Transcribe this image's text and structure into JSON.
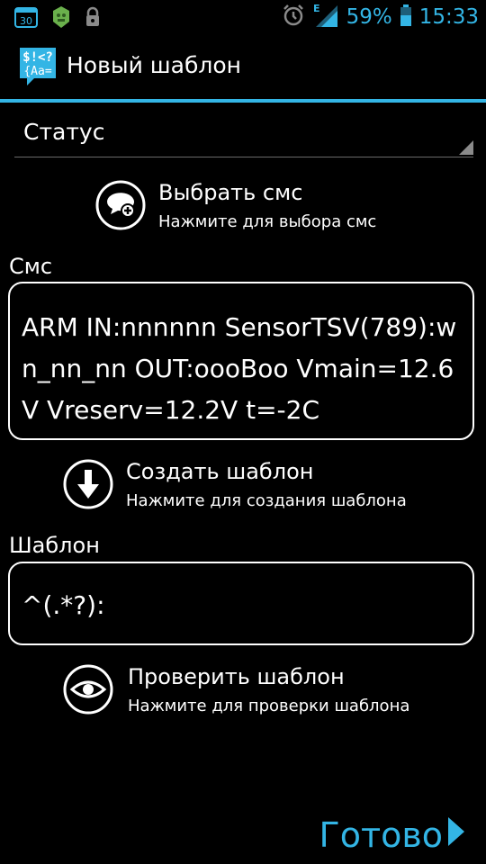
{
  "status_bar": {
    "calendar_day": "30",
    "battery_percent": "59%",
    "network_type": "E",
    "time": "15:33",
    "accent_color": "#33b5e5"
  },
  "action_bar": {
    "app_icon_text_top": "$!<?",
    "app_icon_text_bottom": "{Aa=",
    "title": "Новый шаблон"
  },
  "spinner": {
    "selected_value": "Статус"
  },
  "select_sms": {
    "title": "Выбрать смс",
    "subtitle": "Нажмите для выбора смс",
    "icon": "chat-bubble-plus-icon"
  },
  "sms_section": {
    "label": "Смс",
    "value": "ARM IN:nnnnnn SensorTSV(789):wn_nn_nn OUT:oooBoo Vmain=12.6V Vreserv=12.2V t=-2C"
  },
  "create_template": {
    "title": "Создать шаблон",
    "subtitle": "Нажмите для создания шаблона",
    "icon": "arrow-down-circle-icon"
  },
  "template_section": {
    "label": "Шаблон",
    "value": "^(.*?):"
  },
  "check_template": {
    "title": "Проверить шаблон",
    "subtitle": "Нажмите для проверки шаблона",
    "icon": "eye-icon"
  },
  "footer": {
    "done_label": "Готово"
  }
}
